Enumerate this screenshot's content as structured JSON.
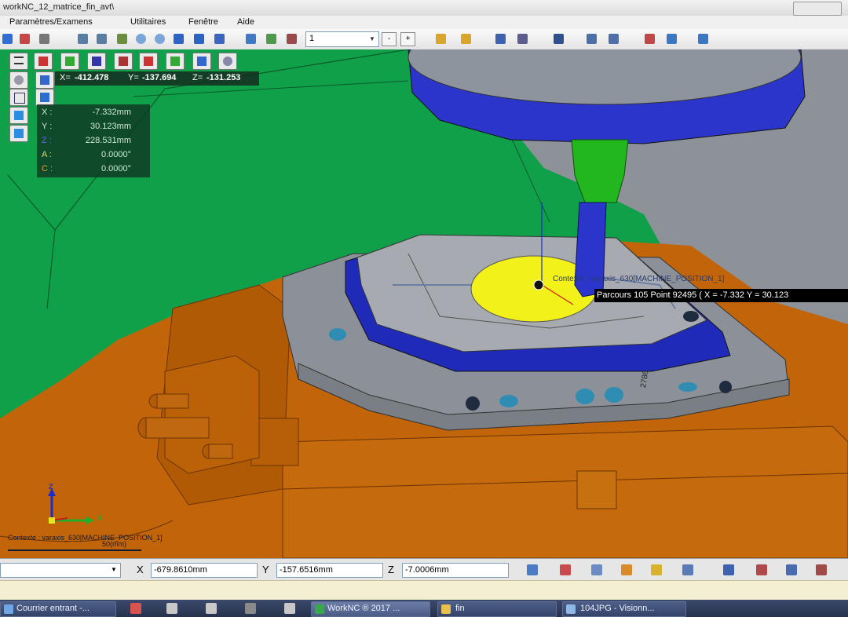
{
  "window": {
    "title": "workNC_12_matrice_fin_avt\\"
  },
  "menu": [
    "Paramètres/Examens",
    "Utilitaires",
    "Fenêtre",
    "Aide"
  ],
  "toolbar": {
    "combo_value": "1",
    "minus_label": "-",
    "plus_label": "+"
  },
  "viewport": {
    "coord_bar": {
      "x_label": "X=",
      "x_value": "-412.478",
      "y_label": "Y=",
      "y_value": "-137.694",
      "z_label": "Z=",
      "z_value": "-131.253"
    },
    "dro": [
      {
        "axis": "X :",
        "value": "-7.332mm"
      },
      {
        "axis": "Y :",
        "value": "30.123mm"
      },
      {
        "axis": "Z :",
        "value": "228.531mm"
      },
      {
        "axis": "A :",
        "value": "0.0000°"
      },
      {
        "axis": "C :",
        "value": "0.0000°"
      }
    ],
    "context_label": "Contexte : varaxis_630[MACHINE_POSITION_1]",
    "tooltip": "Parcours 105 Point 92495 ( X = -7.332  Y = 30.123",
    "part_number": "2786",
    "context_bottom": "Contexte : varaxis_630[MACHINE_POSITION_1]",
    "scale_label": "50(mm)",
    "triad_labels": {
      "z": "Z",
      "x": "X"
    }
  },
  "statusbar": {
    "x_label": "X",
    "x_value": "-679.8610mm",
    "y_label": "Y",
    "y_value": "-157.6516mm",
    "z_label": "Z",
    "z_value": "-7.0006mm"
  },
  "taskbar": [
    {
      "label": "Courrier entrant -...",
      "icon": "mail-icon"
    },
    {
      "label": "WorkNC ® 2017 ...",
      "icon": "worknc-icon"
    },
    {
      "label": "fin",
      "icon": "folder-icon"
    },
    {
      "label": "104JPG - Visionn...",
      "icon": "image-viewer-icon"
    }
  ],
  "colors": {
    "machine_green": "#11a04a",
    "table_orange": "#c2650a",
    "spindle_blue": "#2b35c9",
    "part_grey": "#8f959d",
    "tool_green": "#22b61f",
    "face_yellow": "#f2f21a"
  }
}
